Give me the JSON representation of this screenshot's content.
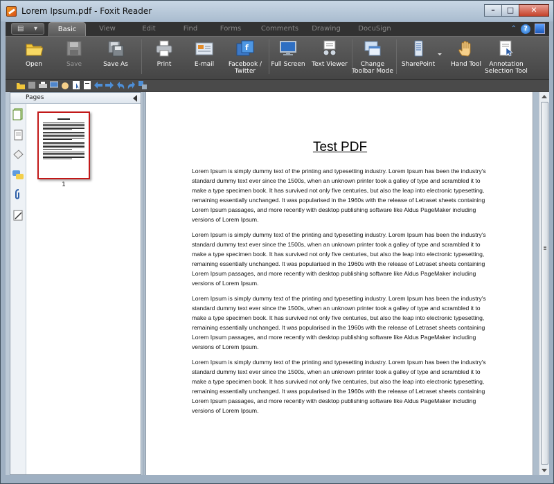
{
  "window": {
    "title": "Lorem Ipsum.pdf - Foxit Reader"
  },
  "tabs": [
    {
      "label": "Basic",
      "active": true
    },
    {
      "label": "View"
    },
    {
      "label": "Edit"
    },
    {
      "label": "Find"
    },
    {
      "label": "Forms"
    },
    {
      "label": "Comments"
    },
    {
      "label": "Drawing"
    },
    {
      "label": "DocuSign"
    }
  ],
  "ribbon": {
    "open": "Open",
    "save": "Save",
    "save_as": "Save As",
    "print": "Print",
    "email": "E-mail",
    "facebook": "Facebook /\nTwitter",
    "full_screen": "Full Screen",
    "text_viewer": "Text Viewer",
    "change_toolbar": "Change\nToolbar Mode",
    "sharepoint": "SharePoint",
    "hand_tool": "Hand Tool",
    "annotation_tool": "Annotation\nSelection Tool"
  },
  "panel": {
    "title": "Pages",
    "page_number": "1"
  },
  "document": {
    "title": "Test PDF",
    "paragraphs": [
      "Lorem Ipsum is simply dummy text of the printing and typesetting industry. Lorem Ipsum has been the industry's standard dummy text ever since the 1500s, when an unknown printer took a galley of type and scrambled it to make a type specimen book. It has survived not only five centuries, but also the leap into electronic typesetting, remaining essentially unchanged. It was popularised in the 1960s with the release of Letraset sheets containing Lorem Ipsum passages, and more recently with desktop publishing software like Aldus PageMaker including versions of Lorem Ipsum.",
      "Lorem Ipsum is simply dummy text of the printing and typesetting industry. Lorem Ipsum has been the industry's standard dummy text ever since the 1500s, when an unknown printer took a galley of type and scrambled it to make a type specimen book. It has survived not only five centuries, but also the leap into electronic typesetting, remaining essentially unchanged. It was popularised in the 1960s with the release of Letraset sheets containing Lorem Ipsum passages, and more recently with desktop publishing software like Aldus PageMaker including versions of Lorem Ipsum.",
      "Lorem Ipsum is simply dummy text of the printing and typesetting industry. Lorem Ipsum has been the industry's standard dummy text ever since the 1500s, when an unknown printer took a galley of type and scrambled it to make a type specimen book. It has survived not only five centuries, but also the leap into electronic typesetting, remaining essentially unchanged. It was popularised in the 1960s with the release of Letraset sheets containing Lorem Ipsum passages, and more recently with desktop publishing software like Aldus PageMaker including versions of Lorem Ipsum.",
      "Lorem Ipsum is simply dummy text of the printing and typesetting industry. Lorem Ipsum has been the industry's standard dummy text ever since the 1500s, when an unknown printer took a galley of type and scrambled it to make a type specimen book. It has survived not only five centuries, but also the leap into electronic typesetting, remaining essentially unchanged. It was popularised in the 1960s with the release of Letraset sheets containing Lorem Ipsum passages, and more recently with desktop publishing software like Aldus PageMaker including versions of Lorem Ipsum."
    ]
  },
  "icons": {
    "app": "foxit-logo-icon",
    "help": "help-icon",
    "skin": "skin-icon"
  },
  "colors": {
    "ribbon": "#4f4f4f",
    "active_tab": "#6a6a6a",
    "thumb_border": "#c21818"
  }
}
